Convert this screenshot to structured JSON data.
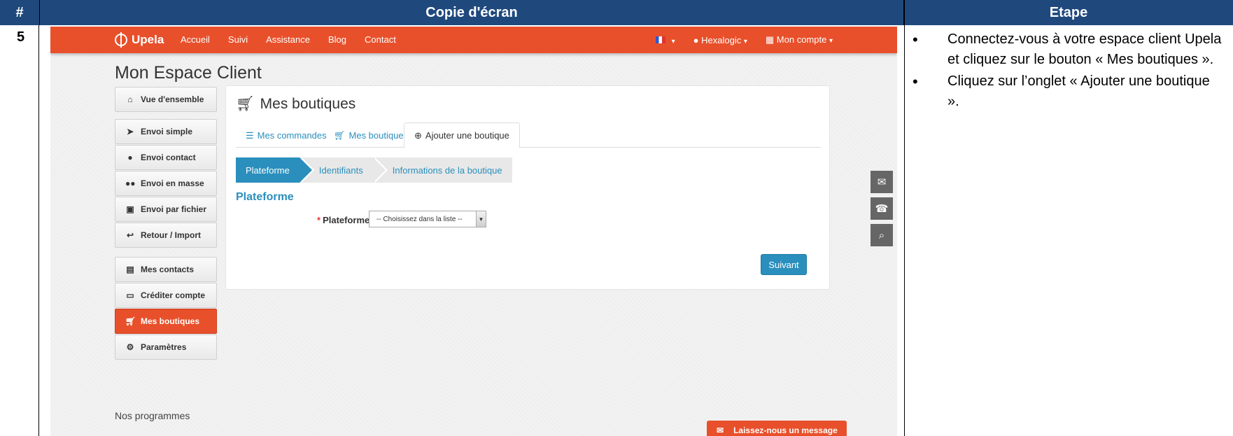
{
  "doc": {
    "header_num": "#",
    "header_screenshot": "Copie d'écran",
    "header_step": "Etape",
    "row_number": "5",
    "steps": [
      "Connectez-vous à votre espace client Upela et cliquez sur le bouton « Mes boutiques ».",
      "Cliquez sur l’onglet « Ajouter une boutique »."
    ]
  },
  "app": {
    "brand": "Upela",
    "nav": [
      "Accueil",
      "Suivi",
      "Assistance",
      "Blog",
      "Contact"
    ],
    "user": "Hexalogic",
    "account": "Mon compte",
    "page_title": "Mon Espace Client",
    "sidebar": [
      {
        "label": "Vue d'ensemble",
        "icon": "home-icon"
      },
      {
        "label": "Envoi simple",
        "icon": "send-icon"
      },
      {
        "label": "Envoi contact",
        "icon": "user-icon"
      },
      {
        "label": "Envoi en masse",
        "icon": "users-icon"
      },
      {
        "label": "Envoi par fichier",
        "icon": "file-icon"
      },
      {
        "label": "Retour / Import",
        "icon": "reply-icon"
      },
      {
        "label": "Mes contacts",
        "icon": "book-icon"
      },
      {
        "label": "Créditer compte",
        "icon": "credit-card-icon"
      },
      {
        "label": "Mes boutiques",
        "icon": "cart-icon"
      },
      {
        "label": "Paramètres",
        "icon": "gears-icon"
      }
    ],
    "programs": "Nos programmes",
    "panel_title": "Mes boutiques",
    "tabs": [
      "Mes commandes",
      "Mes boutiques",
      "Ajouter une boutique"
    ],
    "wizard": [
      "Plateforme",
      "Identifiants",
      "Informations de la boutique"
    ],
    "section_title": "Plateforme",
    "field_label": "Plateforme",
    "select_value": "-- Choisissez dans la liste --",
    "next_label": "Suivant",
    "message_label": "Laissez-nous un message",
    "colors": {
      "brand": "#e8502b",
      "accent": "#2a8fbd",
      "header": "#1f497d"
    }
  }
}
